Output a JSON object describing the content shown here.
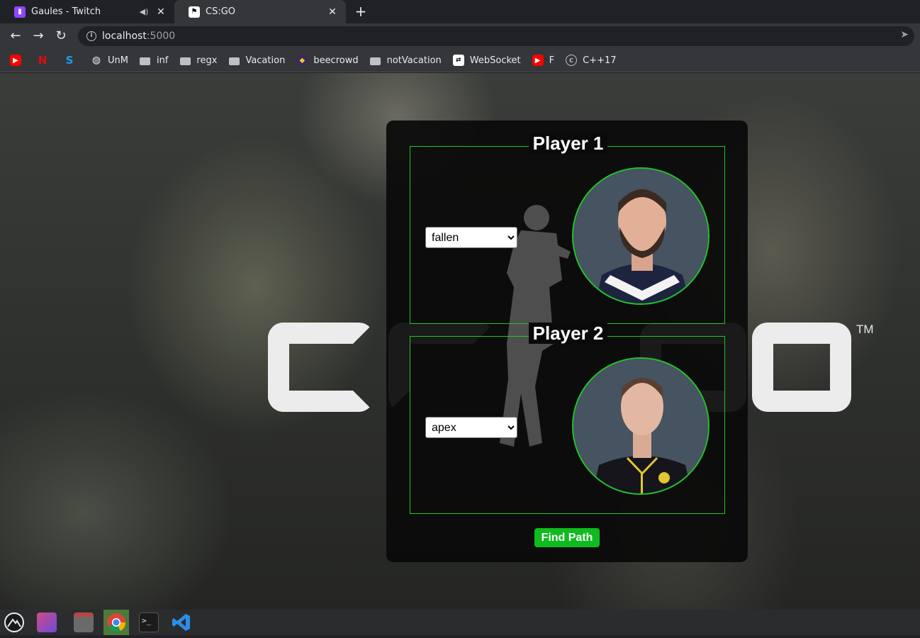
{
  "browser": {
    "tabs": [
      {
        "title": "Gaules - Twitch",
        "favicon": "twitch-icon",
        "audio": "speaker-icon"
      },
      {
        "title": "CS:GO",
        "favicon": "csgo-icon"
      }
    ],
    "new_tab_icon": "plus-icon",
    "address": {
      "host": "localhost",
      "port": ":5000"
    },
    "bookmarks": [
      {
        "label": "",
        "icon": "youtube-icon"
      },
      {
        "label": "",
        "icon": "netflix-icon"
      },
      {
        "label": "",
        "icon": "skype-icon"
      },
      {
        "label": "UnM",
        "icon": "globe-icon"
      },
      {
        "label": "inf",
        "icon": "folder-icon"
      },
      {
        "label": "regx",
        "icon": "folder-icon"
      },
      {
        "label": "Vacation",
        "icon": "folder-icon"
      },
      {
        "label": "beecrowd",
        "icon": "beecrowd-icon"
      },
      {
        "label": "notVacation",
        "icon": "folder-icon"
      },
      {
        "label": "WebSocket",
        "icon": "websocket-icon"
      },
      {
        "label": "F",
        "icon": "youtube-icon"
      },
      {
        "label": "C++17",
        "icon": "cpp-icon"
      }
    ]
  },
  "page": {
    "logo_text": "CS:GO",
    "logo_tm": "TM",
    "player1": {
      "title": "Player 1",
      "selected": "fallen"
    },
    "player2": {
      "title": "Player 2",
      "selected": "apex"
    },
    "find_button": "Find Path",
    "accent_color": "#22c32a",
    "button_color": "#10bb20"
  },
  "taskbar": {
    "apps": [
      "launcher-icon",
      "gradient-app-icon",
      "files-icon",
      "chrome-icon",
      "terminal-icon",
      "vscode-icon"
    ]
  }
}
